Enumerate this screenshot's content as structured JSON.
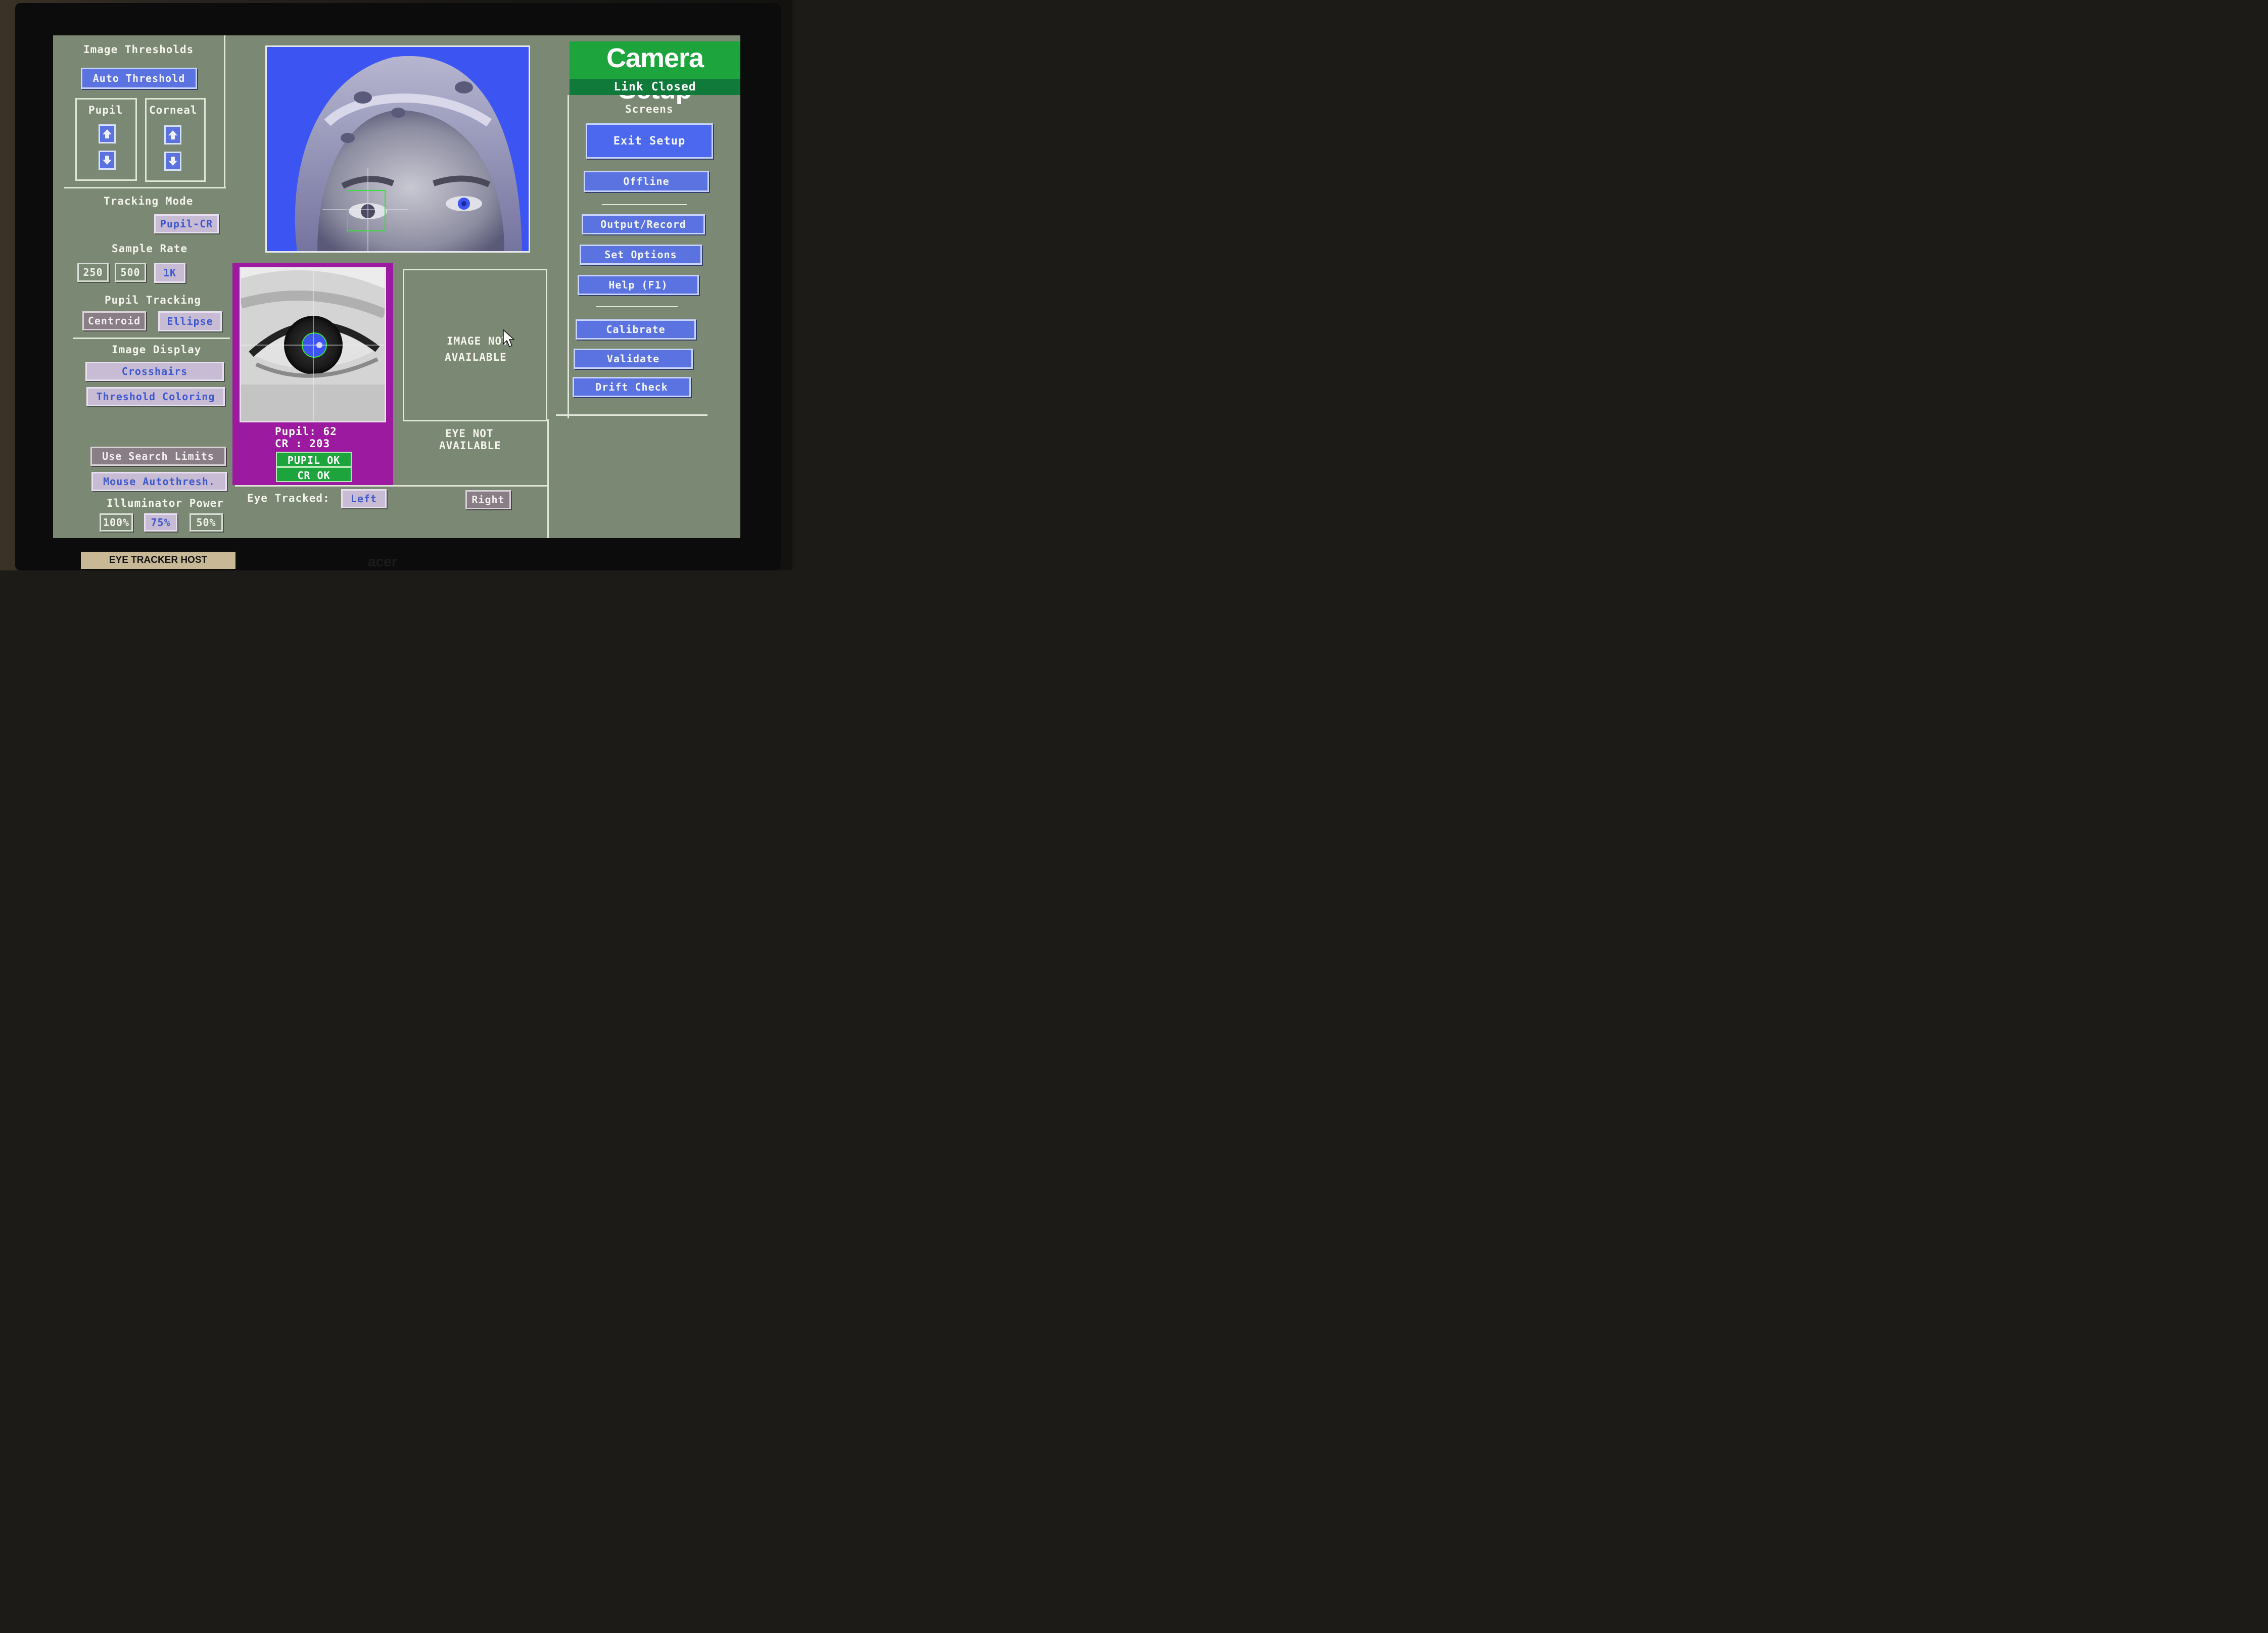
{
  "title": "Camera Setup",
  "link_status": "Link Closed",
  "image_thresholds": {
    "heading": "Image Thresholds",
    "auto_threshold": "Auto Threshold",
    "pupil_label": "Pupil",
    "corneal_label": "Corneal"
  },
  "tracking_mode": {
    "heading": "Tracking Mode",
    "value": "Pupil-CR"
  },
  "sample_rate": {
    "heading": "Sample Rate",
    "options": [
      "250",
      "500",
      "1K"
    ],
    "selected": "1K"
  },
  "pupil_tracking": {
    "heading": "Pupil Tracking",
    "options": [
      "Centroid",
      "Ellipse"
    ],
    "selected": "Ellipse"
  },
  "image_display": {
    "heading": "Image Display",
    "crosshairs": "Crosshairs",
    "threshold_coloring": "Threshold Coloring"
  },
  "search": {
    "use_search_limits": "Use Search Limits",
    "mouse_autothresh": "Mouse Autothresh."
  },
  "illuminator": {
    "heading": "Illuminator Power",
    "options": [
      "100%",
      "75%",
      "50%"
    ],
    "selected": "75%"
  },
  "eye_status": {
    "pupil": "Pupil: 62",
    "cr": "CR   : 203",
    "pupil_ok": "PUPIL OK",
    "cr_ok": "CR  OK"
  },
  "right_eye": {
    "image_na_1": "IMAGE NOT",
    "image_na_2": "AVAILABLE",
    "eye_na_1": "EYE NOT",
    "eye_na_2": "AVAILABLE"
  },
  "eye_tracked": {
    "label": "Eye Tracked:",
    "left": "Left",
    "right": "Right",
    "selected": "Left"
  },
  "screens": {
    "heading": "Screens",
    "exit_setup": "Exit Setup",
    "offline": "Offline",
    "output_record": "Output/Record",
    "set_options": "Set Options",
    "help": "Help (F1)",
    "calibrate": "Calibrate",
    "validate": "Validate",
    "drift_check": "Drift Check"
  },
  "monitor_label": "EYE TRACKER HOST",
  "brand": "acer",
  "colors": {
    "screen_bg": "#7a8874",
    "button_blue": "#5a73e0",
    "title_green": "#1ea43c",
    "eye_panel": "#9c1aa0"
  }
}
